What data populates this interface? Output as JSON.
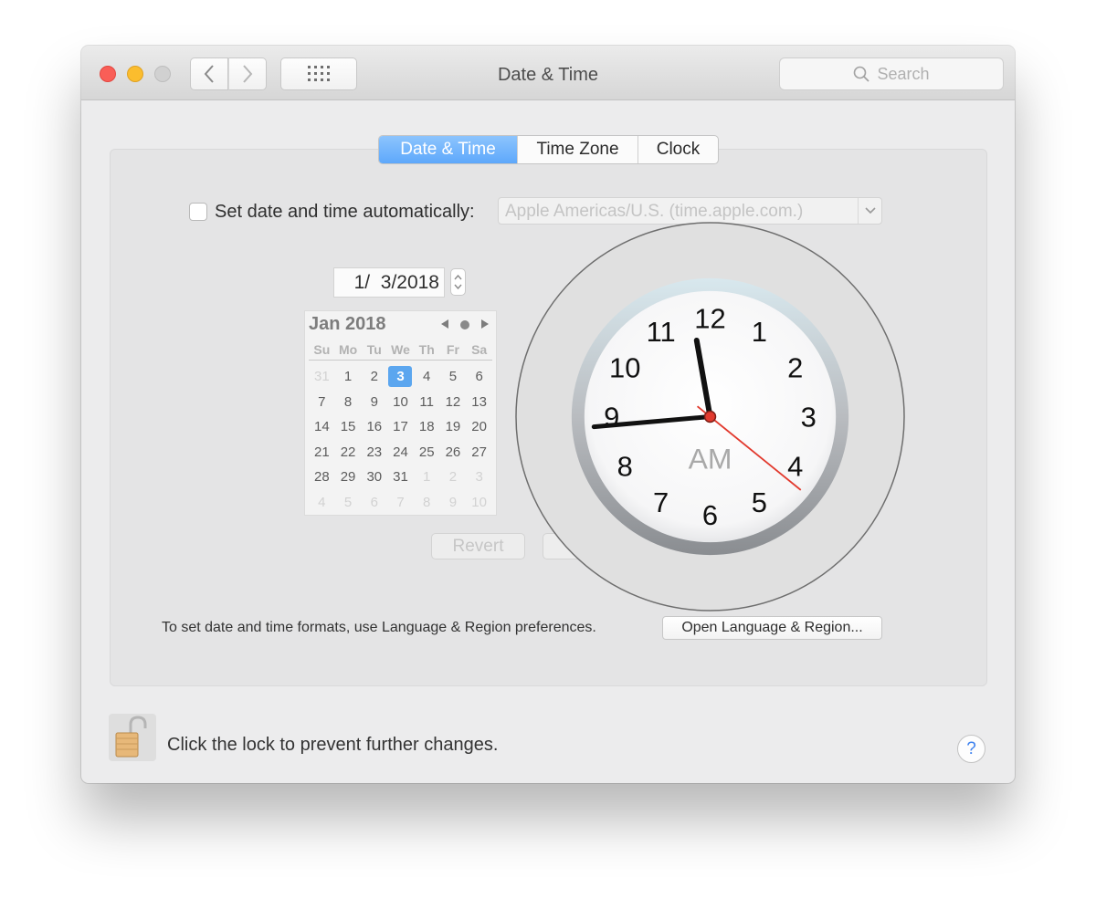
{
  "window": {
    "title": "Date & Time",
    "search_placeholder": "Search"
  },
  "toolbar": {
    "traffic_lights": [
      "close",
      "minimize",
      "zoom"
    ],
    "buttons": [
      "back-arrow",
      "forward-arrow",
      "show-all-grid"
    ]
  },
  "tabs": [
    {
      "label": "Date & Time",
      "active": true
    },
    {
      "label": "Time Zone",
      "active": false
    },
    {
      "label": "Clock",
      "active": false
    }
  ],
  "auto_time": {
    "label": "Set date and time automatically:",
    "checked": false,
    "server": "Apple Americas/U.S. (time.apple.com.)"
  },
  "date_field": {
    "value": "1/  3/2018"
  },
  "calendar": {
    "month_label": "Jan 2018",
    "weekdays": [
      "Su",
      "Mo",
      "Tu",
      "We",
      "Th",
      "Fr",
      "Sa"
    ],
    "days": [
      {
        "d": "31",
        "other": true
      },
      {
        "d": "1"
      },
      {
        "d": "2"
      },
      {
        "d": "3",
        "selected": true
      },
      {
        "d": "4"
      },
      {
        "d": "5"
      },
      {
        "d": "6"
      },
      {
        "d": "7"
      },
      {
        "d": "8"
      },
      {
        "d": "9"
      },
      {
        "d": "10"
      },
      {
        "d": "11"
      },
      {
        "d": "12"
      },
      {
        "d": "13"
      },
      {
        "d": "14"
      },
      {
        "d": "15"
      },
      {
        "d": "16"
      },
      {
        "d": "17"
      },
      {
        "d": "18"
      },
      {
        "d": "19"
      },
      {
        "d": "20"
      },
      {
        "d": "21"
      },
      {
        "d": "22"
      },
      {
        "d": "23"
      },
      {
        "d": "24"
      },
      {
        "d": "25"
      },
      {
        "d": "26"
      },
      {
        "d": "27"
      },
      {
        "d": "28"
      },
      {
        "d": "29"
      },
      {
        "d": "30"
      },
      {
        "d": "31"
      },
      {
        "d": "1",
        "other": true
      },
      {
        "d": "2",
        "other": true
      },
      {
        "d": "3",
        "other": true
      },
      {
        "d": "4",
        "other": true
      },
      {
        "d": "5",
        "other": true
      },
      {
        "d": "6",
        "other": true
      },
      {
        "d": "7",
        "other": true
      },
      {
        "d": "8",
        "other": true
      },
      {
        "d": "9",
        "other": true
      },
      {
        "d": "10",
        "other": true
      }
    ],
    "selected_color": "#5ba6ef"
  },
  "buttons": {
    "revert": "Revert"
  },
  "clock": {
    "numerals": [
      "12",
      "1",
      "2",
      "3",
      "4",
      "5",
      "6",
      "7",
      "8",
      "9",
      "10",
      "11"
    ],
    "period": "AM",
    "hour_hand_angle_deg": -10,
    "minute_hand_angle_deg": -95,
    "second_hand_angle_deg": 129,
    "second_hand_color": "#e23a2e"
  },
  "formats": {
    "text": "To set date and time formats, use Language & Region preferences.",
    "button": "Open Language & Region..."
  },
  "lock": {
    "text": "Click the lock to prevent further changes."
  },
  "help": {
    "label": "?"
  }
}
